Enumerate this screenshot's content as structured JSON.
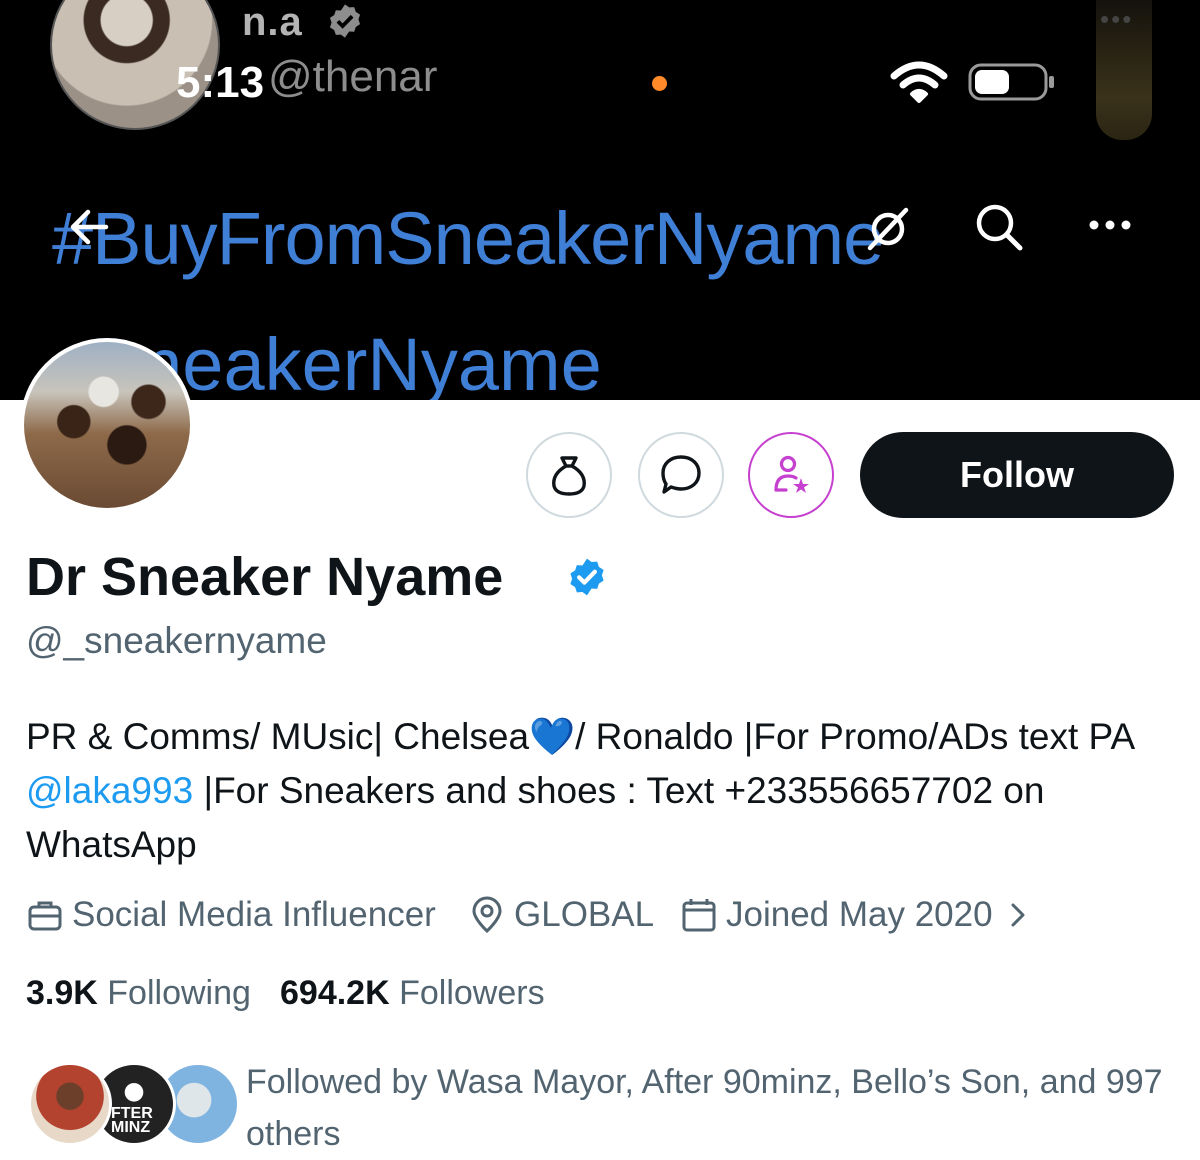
{
  "banner": {
    "account_name": "n.a",
    "account_handle": "@thenar",
    "hashtag": "#BuyFromSneakerNyame",
    "handle_text": "_neakerNyame_"
  },
  "status_bar": {
    "time": "5:13"
  },
  "actions": {
    "follow_label": "Follow"
  },
  "profile": {
    "display_name": "Dr Sneaker Nyame",
    "username": "@_sneakernyame",
    "bio_part1": "PR & Comms/ MUsic| Chelsea",
    "bio_heart": "💙",
    "bio_part2": "/ Ronaldo |For Promo/ADs text PA ",
    "bio_mention": "@laka993",
    "bio_part3": " |For Sneakers and shoes : Text +233556657702 on WhatsApp",
    "category": "Social Media Influencer",
    "location": "GLOBAL",
    "joined": "Joined May 2020"
  },
  "stats": {
    "following_count": "3.9K",
    "following_label": "Following",
    "followers_count": "694.2K",
    "followers_label": "Followers"
  },
  "mutuals": {
    "avatar2_text": "FTER MINZ",
    "followed_by_text": "Followed by Wasa Mayor, After 90minz, Bello’s Son, and 997 others"
  },
  "colors": {
    "link": "#1d9bf0",
    "verified": "#1d9bf0",
    "subscribe": "#c640cf",
    "banner_text": "#3f7fd6"
  },
  "icons": [
    "back-icon",
    "hide-icon",
    "search-icon",
    "more-icon",
    "tip-icon",
    "message-icon",
    "subscribe-icon",
    "verified-icon",
    "briefcase-icon",
    "location-icon",
    "calendar-icon",
    "chevron-right-icon",
    "wifi-icon",
    "battery-icon"
  ]
}
